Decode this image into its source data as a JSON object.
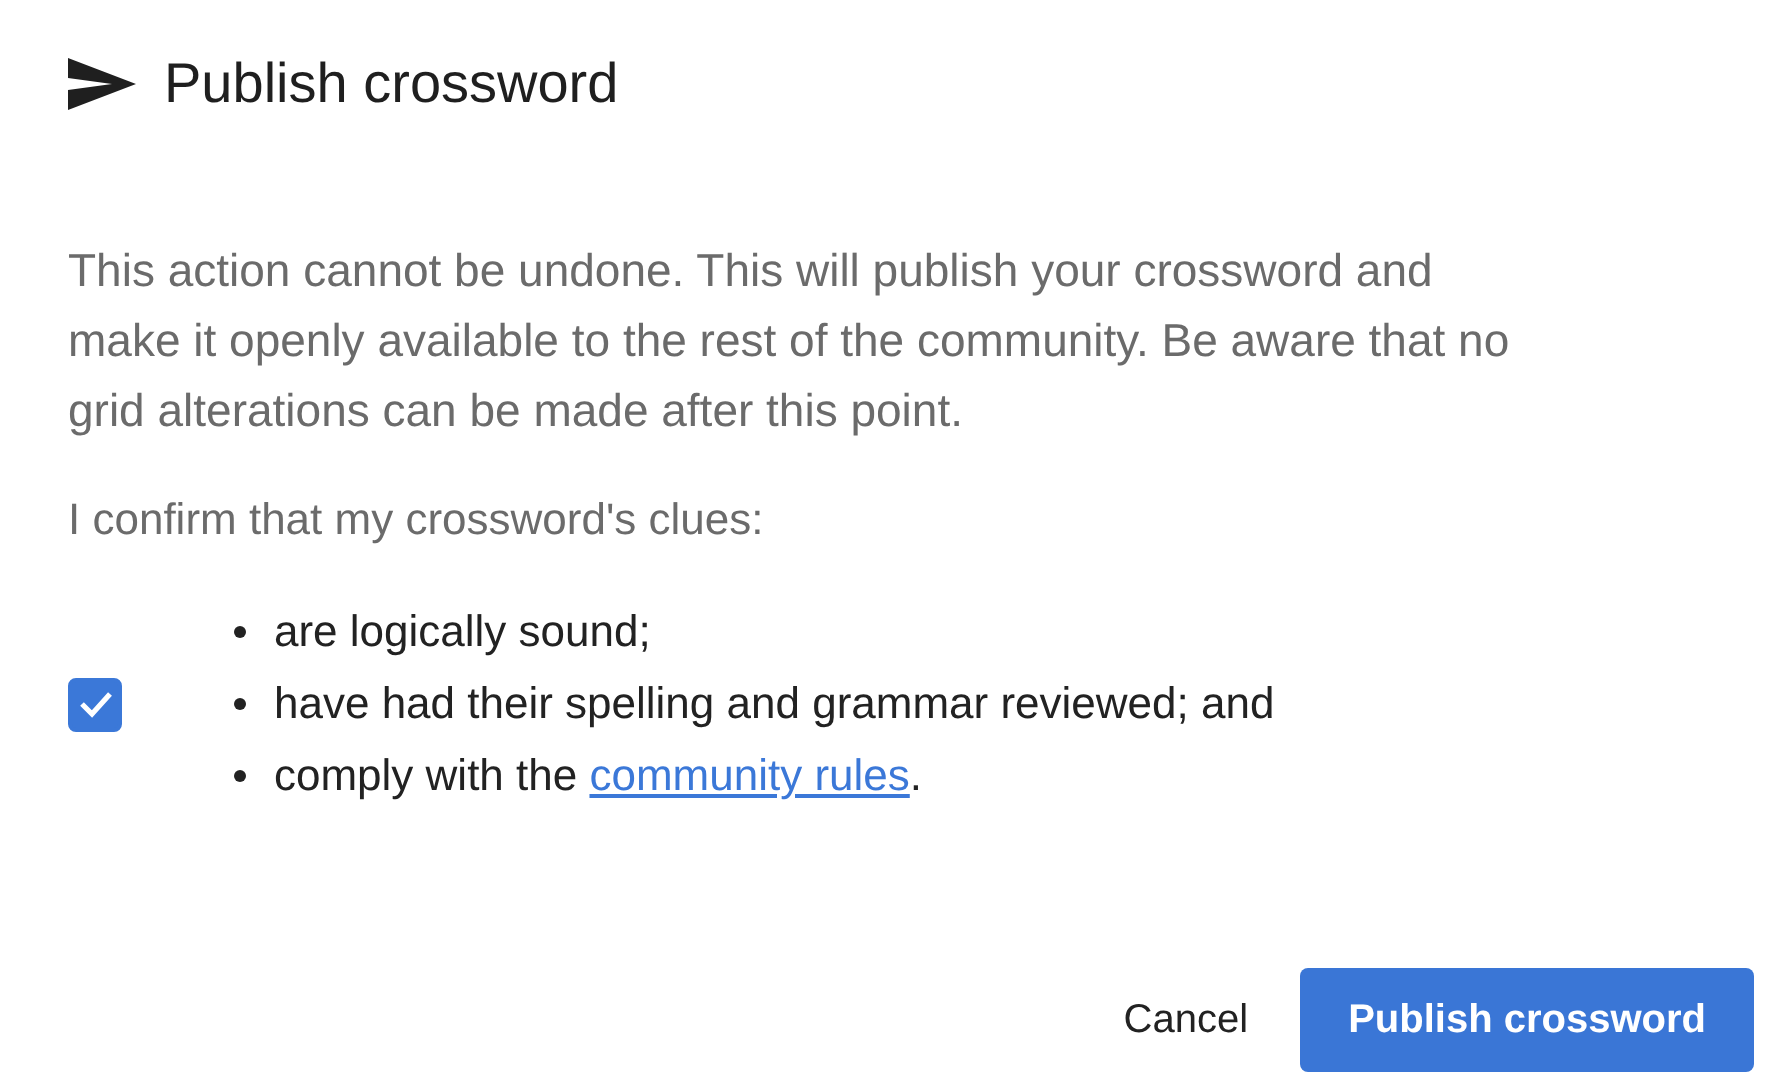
{
  "dialog": {
    "title": "Publish crossword",
    "description": "This action cannot be undone. This will publish your crossword and make it openly available to the rest of the community. Be aware that no grid alterations can be made after this point.",
    "confirm_label": "I confirm that my crossword's clues:",
    "checkbox": {
      "checked": true
    },
    "clues": [
      {
        "text": "are logically sound;"
      },
      {
        "text": "have had their spelling and grammar reviewed; and"
      },
      {
        "text": "comply with the ",
        "link": "community rules",
        "after": "."
      }
    ],
    "buttons": [
      {
        "label": "Cancel",
        "kind": "secondary"
      },
      {
        "label": "Publish crossword",
        "kind": "primary"
      }
    ]
  }
}
